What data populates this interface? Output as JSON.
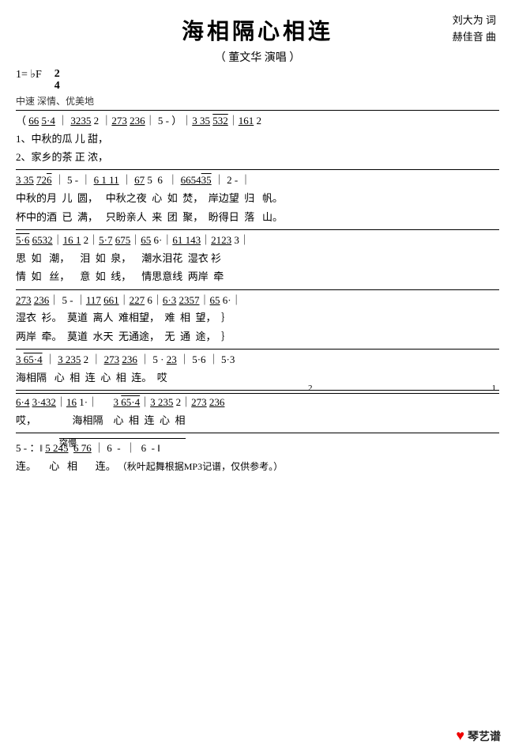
{
  "title": "海相隔心相连",
  "subtitle": "（ 董文华 演唱 ）",
  "credits": {
    "lyricist": "刘大为 词",
    "composer": "赫佳音 曲"
  },
  "meta": {
    "key": "1= ♭F",
    "time_num": "2",
    "time_den": "4",
    "tempo": "中速 深情、优美地"
  },
  "watermark": {
    "logo": "♥琴艺谱",
    "note": "秋叶起舞根据MP3记谱，仅供参考。"
  },
  "lines": [
    {
      "id": "line1",
      "notation": "（ <u>66</u> <u>5·4</u> ｜ <u>3235</u> 2 ｜<u>273</u> <u>236</u>｜ 5 - ）｜<u>3 35</u> <u>532</u>｜<u>161</u> 2",
      "lyrics1": "1、中秋的瓜 儿 甜，",
      "lyrics2": "2、家乡的茶 正 浓，"
    },
    {
      "id": "line2",
      "notation": "<u>3 35</u> <u>726</u> ｜ 5 - ｜ <u>6 1 11</u> ｜ <u>67</u> 5  6  ｜ <u>665435</u> ｜ 2 - ｜",
      "lyrics1": "中秋的月  儿  圆，   中秋之夜  心  如  焚，  岸边望  归   帆。",
      "lyrics2": "杯中的酒  已  满，   只盼亲人  来  团  聚，  盼得日  落   山。"
    },
    {
      "id": "line3",
      "notation": "<u>5·6</u> <u>6532</u>｜<u>16 1</u> 2｜<u>5·7</u> <u>675</u>｜<u>65</u> 6·｜<u>61 143</u>｜<u>2123</u> 3｜",
      "lyrics1": "思  如   潮，    泪  如  泉，    潮水泪花  湿衣 衫",
      "lyrics2": "情  如   丝，    意  如  线，    情思意线  两岸  牵"
    },
    {
      "id": "line4",
      "notation": "<u>273</u> <u>236</u>｜ 5 - ｜<u>117</u> <u>661</u>｜<u>227</u> 6｜<u>6·3</u> <u>2357</u>｜<u>65</u> 6·｜",
      "lyrics1": "湿衣  衫。  莫道  离人  难相望，  难  相  望，",
      "lyrics2": "两岸  牵。  莫道  水天  无通途，  无  通  途，"
    },
    {
      "id": "line5",
      "notation": "<u>3 65·4</u> ｜ <u>3 235</u> 2 ｜ <u>273</u> <u>236</u> ｜ 5 · <u>23</u> ｜ 5·6 ｜ 5·3",
      "lyrics1": "海相隔   心  相  连  心  相  连。  哎"
    },
    {
      "id": "line6",
      "notation": "<u>6·4</u> <u>3·432</u>｜<u>16</u> 1·｜      <u>3 65·4</u>｜<u>3 235</u> 2｜<u>273</u> <u>236</u>",
      "lyrics1": "哎，              海相隔    心  相  连  心  相"
    },
    {
      "id": "line7",
      "notation": "5 - ：‖ <u>5 245</u>  <u>6 76</u> ｜ 6  -  ｜  6  -  ‖",
      "lyrics1": "连。     心   相       连。"
    }
  ]
}
